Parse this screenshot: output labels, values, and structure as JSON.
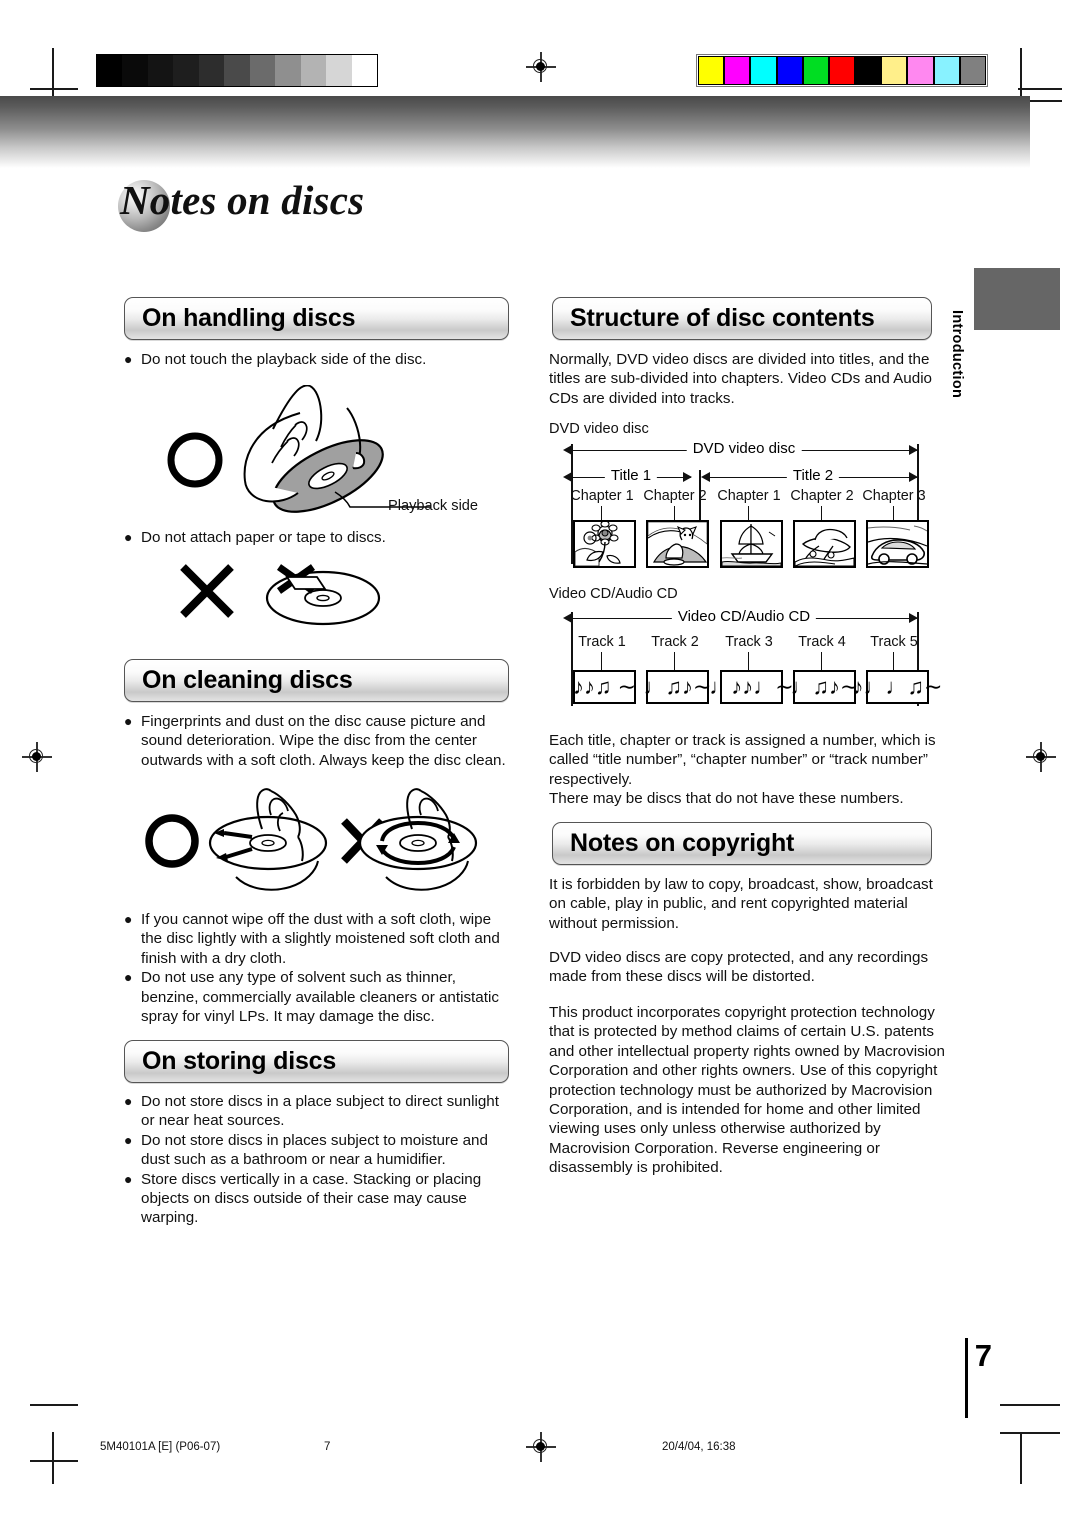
{
  "document": {
    "page_title": "Notes on discs",
    "page_number": "7",
    "side_tab": "Introduction"
  },
  "printmarks": {
    "grayscale_steps": [
      "#000000",
      "#0a0a0a",
      "#141414",
      "#1e1e1e",
      "#2d2d2d",
      "#4a4a4a",
      "#6b6b6b",
      "#8f8f8f",
      "#b3b3b3",
      "#d6d6d6",
      "#ffffff"
    ],
    "color_swatches": [
      "#ffff00",
      "#ff00ff",
      "#00ffff",
      "#0000ff",
      "#00dd22",
      "#ff0000",
      "#000000",
      "#ffef8a",
      "#ff88f0",
      "#88f2ff",
      "#808080"
    ]
  },
  "left_column": {
    "handling": {
      "heading": "On handling discs",
      "bullets": [
        "Do not touch the playback side of the disc.",
        "Do not attach paper or tape to discs."
      ],
      "callout": "Playback side"
    },
    "cleaning": {
      "heading": "On cleaning discs",
      "bullets": [
        "Fingerprints and dust on the disc cause picture and sound deterioration. Wipe the disc from the center outwards with a soft cloth. Always keep the disc clean.",
        "If you cannot wipe off the dust with a soft cloth, wipe the disc lightly with a slightly moistened soft cloth and finish with a dry cloth.",
        "Do not use any type of solvent such as thinner, benzine, commercially available cleaners or antistatic spray for vinyl LPs. It may damage the disc."
      ]
    },
    "storing": {
      "heading": "On storing discs",
      "bullets": [
        "Do not store discs in a place subject to direct sunlight or near heat sources.",
        "Do not store discs in places subject to moisture and dust such as a bathroom or near a humidifier.",
        "Store discs vertically in a case. Stacking or placing objects on discs outside of their case may cause warping."
      ]
    }
  },
  "right_column": {
    "structure": {
      "heading": "Structure of disc contents",
      "intro": "Normally, DVD video discs are divided into titles, and the titles are sub-divided into chapters. Video CDs and Audio CDs are divided into tracks.",
      "dvd_caption": "DVD video disc",
      "dvd_diagram": {
        "span_label": "DVD video disc",
        "titles": [
          {
            "label": "Title 1",
            "chapters": [
              "Chapter 1",
              "Chapter 2"
            ]
          },
          {
            "label": "Title 2",
            "chapters": [
              "Chapter 1",
              "Chapter 2",
              "Chapter 3"
            ]
          }
        ]
      },
      "cd_caption": "Video CD/Audio CD",
      "cd_diagram": {
        "span_label": "Video CD/Audio CD",
        "tracks": [
          {
            "label": "Track 1",
            "glyphs": "♪♪♫ ∼"
          },
          {
            "label": "Track 2",
            "glyphs": "♩♫♪∼"
          },
          {
            "label": "Track 3",
            "glyphs": "♩♪♪♩∼"
          },
          {
            "label": "Track 4",
            "glyphs": "♩♫♪∼"
          },
          {
            "label": "Track 5",
            "glyphs": "♪♩♩♫∼"
          }
        ]
      },
      "outro": "Each title, chapter or track is assigned a number, which is called “title number”, “chapter number” or “track number” respectively.\nThere may be discs that do not have these numbers."
    },
    "copyright": {
      "heading": "Notes on copyright",
      "paragraphs": [
        "It is forbidden by law to copy, broadcast, show, broadcast on cable, play in public, and rent copyrighted material without permission.",
        "DVD video discs are copy protected, and any recordings made from these discs will be distorted.",
        "This product incorporates copyright protection technology that is protected by method claims of certain U.S. patents and other intellectual property rights owned by Macrovision Corporation and other rights owners. Use of this copyright protection technology must be authorized by Macrovision Corporation, and is intended for home and other limited viewing uses only unless otherwise authorized by Macrovision Corporation. Reverse engineering or disassembly is prohibited."
      ]
    }
  },
  "footer": {
    "doc_code": "5M40101A [E] (P06-07)",
    "center_page": "7",
    "timestamp": "20/4/04, 16:38"
  }
}
